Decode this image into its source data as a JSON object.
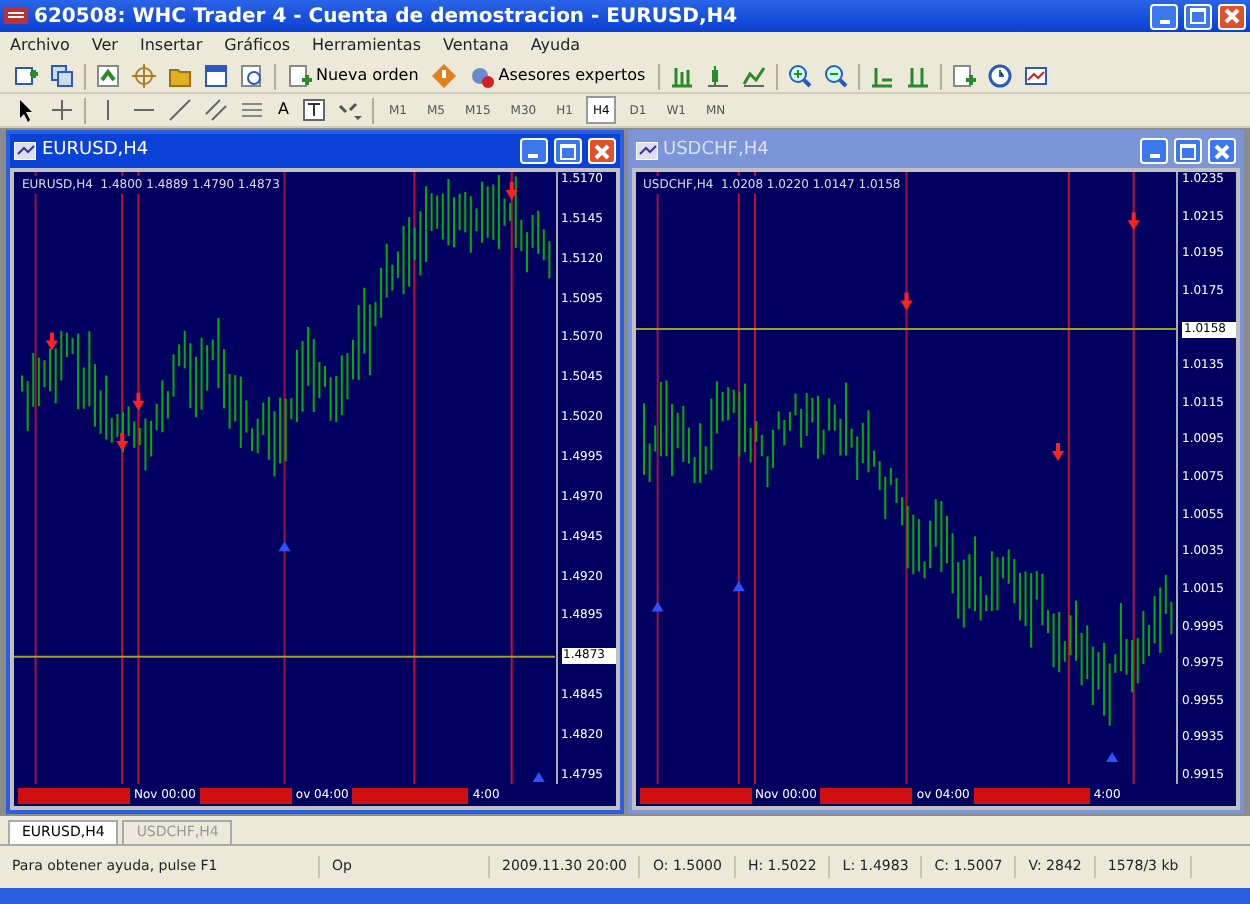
{
  "window": {
    "title": "620508: WHC Trader 4 - Cuenta de demostracion - EURUSD,H4"
  },
  "menu": [
    "Archivo",
    "Ver",
    "Insertar",
    "Gráficos",
    "Herramientas",
    "Ventana",
    "Ayuda"
  ],
  "toolbar": {
    "buttons": [
      {
        "label": "Nueva orden"
      },
      {
        "label": "Asesores expertos"
      }
    ],
    "text_tool": "A",
    "timeframes": [
      {
        "label": "M1",
        "selected": false
      },
      {
        "label": "M5",
        "selected": false
      },
      {
        "label": "M15",
        "selected": false
      },
      {
        "label": "M30",
        "selected": false
      },
      {
        "label": "H1",
        "selected": false
      },
      {
        "label": "H4",
        "selected": true
      },
      {
        "label": "D1",
        "selected": false
      },
      {
        "label": "W1",
        "selected": false
      },
      {
        "label": "MN",
        "selected": false
      }
    ]
  },
  "charts": [
    {
      "title": "EURUSD,H4",
      "active": true,
      "info": "EURUSD,H4  1.4800 1.4889 1.4790 1.4873",
      "price_labels": [
        {
          "text": "1.5170",
          "kind": "tick"
        },
        {
          "text": "1.5145",
          "kind": "tick"
        },
        {
          "text": "1.5120",
          "kind": "tick"
        },
        {
          "text": "1.5095",
          "kind": "tick"
        },
        {
          "text": "1.5070",
          "kind": "tick"
        },
        {
          "text": "1.5045",
          "kind": "tick"
        },
        {
          "text": "1.5020",
          "kind": "tick"
        },
        {
          "text": "1.4995",
          "kind": "tick"
        },
        {
          "text": "1.4970",
          "kind": "tick"
        },
        {
          "text": "1.4945",
          "kind": "tick"
        },
        {
          "text": "1.4920",
          "kind": "tick"
        },
        {
          "text": "1.4895",
          "kind": "tick"
        },
        {
          "text": "1.4873",
          "kind": "current"
        },
        {
          "text": "1.4845",
          "kind": "tick"
        },
        {
          "text": "1.4820",
          "kind": "tick"
        },
        {
          "text": "1.4795",
          "kind": "tick"
        }
      ],
      "time_labels": [
        "Nov 00:00",
        "ov 04:00",
        "4:00"
      ]
    },
    {
      "title": "USDCHF,H4",
      "active": false,
      "info": "USDCHF,H4  1.0208 1.0220 1.0147 1.0158",
      "price_labels": [
        {
          "text": "1.0235",
          "kind": "tick"
        },
        {
          "text": "1.0215",
          "kind": "tick"
        },
        {
          "text": "1.0195",
          "kind": "tick"
        },
        {
          "text": "1.0175",
          "kind": "tick"
        },
        {
          "text": "1.0158",
          "kind": "current"
        },
        {
          "text": "1.0135",
          "kind": "tick"
        },
        {
          "text": "1.0115",
          "kind": "tick"
        },
        {
          "text": "1.0095",
          "kind": "tick"
        },
        {
          "text": "1.0075",
          "kind": "tick"
        },
        {
          "text": "1.0055",
          "kind": "tick"
        },
        {
          "text": "1.0035",
          "kind": "tick"
        },
        {
          "text": "1.0015",
          "kind": "tick"
        },
        {
          "text": "0.9995",
          "kind": "tick"
        },
        {
          "text": "0.9975",
          "kind": "tick"
        },
        {
          "text": "0.9955",
          "kind": "tick"
        },
        {
          "text": "0.9935",
          "kind": "tick"
        },
        {
          "text": "0.9915",
          "kind": "tick"
        }
      ],
      "time_labels": [
        "Nov 00:00",
        "ov 04:00",
        "4:00"
      ]
    }
  ],
  "tabs": [
    {
      "label": "EURUSD,H4",
      "selected": true
    },
    {
      "label": "USDCHF,H4",
      "selected": false
    }
  ],
  "status_bar": [
    "Para obtener ayuda, pulse F1",
    "Op",
    "2009.11.30 20:00",
    "O: 1.5000",
    "H: 1.5022",
    "L: 1.4983",
    "C: 1.5007",
    "V: 2842",
    "1578/3 kb"
  ]
}
